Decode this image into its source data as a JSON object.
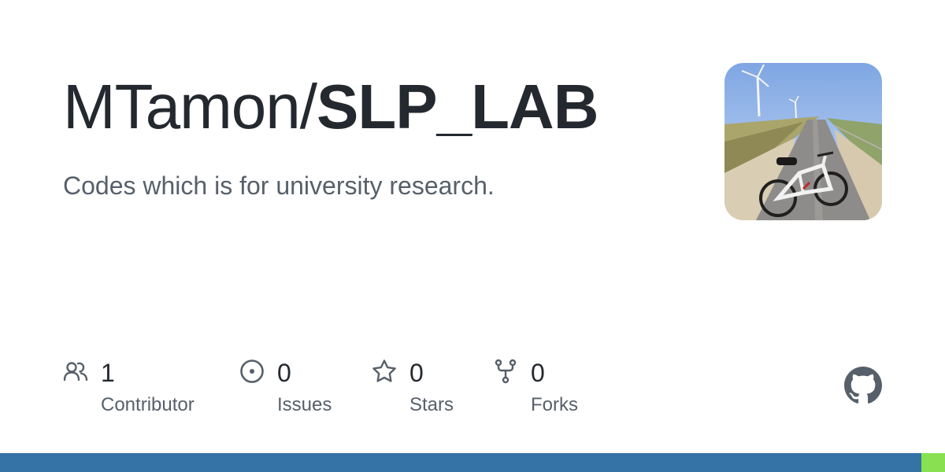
{
  "repo": {
    "owner": "MTamon/",
    "name": "SLP_LAB",
    "description": "Codes which is for university research."
  },
  "avatar": {
    "icon": "avatar-photo-bicycle"
  },
  "stats": [
    {
      "count": "1",
      "label": "Contributor",
      "icon": "people-icon"
    },
    {
      "count": "0",
      "label": "Issues",
      "icon": "issue-opened-icon"
    },
    {
      "count": "0",
      "label": "Stars",
      "icon": "star-icon"
    },
    {
      "count": "0",
      "label": "Forks",
      "icon": "repo-forked-icon"
    }
  ],
  "logo": {
    "icon": "github-mark-icon",
    "color": "#57606a"
  },
  "languages": [
    {
      "color": "#3572A5",
      "percent": 97.5
    },
    {
      "color": "#89e051",
      "percent": 2.5
    }
  ]
}
